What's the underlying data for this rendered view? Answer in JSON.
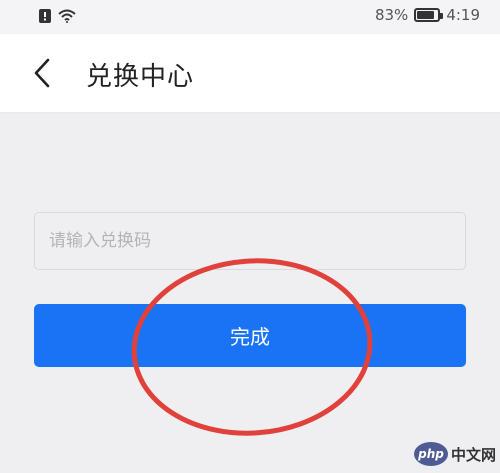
{
  "status_bar": {
    "battery_percent": "83%",
    "time": "4:19",
    "battery_level": 0.83,
    "icons": [
      "notification-icon",
      "wifi-icon",
      "battery-icon"
    ]
  },
  "nav": {
    "back_icon": "back-arrow-icon",
    "title": "兑换中心"
  },
  "form": {
    "code_placeholder": "请输入兑换码",
    "code_value": "",
    "submit_label": "完成"
  },
  "colors": {
    "primary": "#1a72f5",
    "annotation": "#e0413a",
    "background": "#efeff1"
  },
  "watermark": {
    "text": "中文网",
    "logo_text": "php"
  }
}
